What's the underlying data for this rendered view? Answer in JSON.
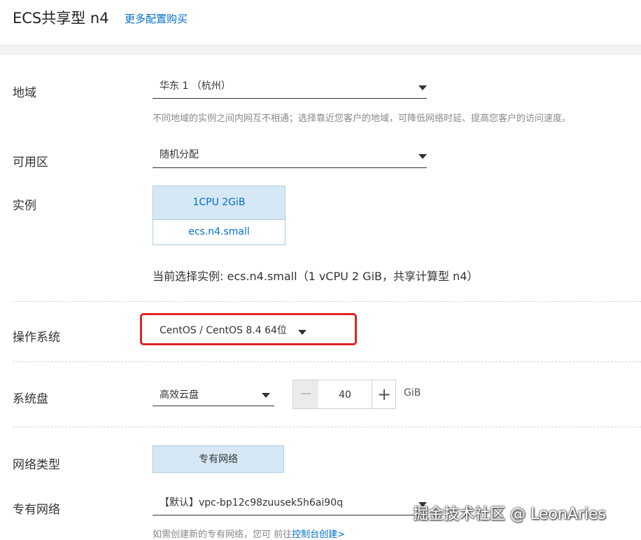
{
  "header": {
    "title": "ECS共享型 n4",
    "more_link": "更多配置购买"
  },
  "region": {
    "label": "地域",
    "value": "华东 1 （杭州）",
    "hint": "不同地域的实例之间内网互不相通；选择靠近您客户的地域，可降低网络时延、提高您客户的访问速度。"
  },
  "zone": {
    "label": "可用区",
    "value": "随机分配"
  },
  "instance": {
    "label": "实例",
    "card_spec": "1CPU 2GiB",
    "card_type": "ecs.n4.small",
    "current": "当前选择实例: ecs.n4.small（1 vCPU 2 GiB，共享计算型 n4）"
  },
  "os": {
    "label": "操作系统",
    "value": "CentOS / CentOS 8.4 64位"
  },
  "disk": {
    "label": "系统盘",
    "type": "高效云盘",
    "minus": "−",
    "size": "40",
    "plus": "+",
    "unit": "GiB"
  },
  "network_type": {
    "label": "网络类型",
    "button": "专有网络"
  },
  "vpc": {
    "label": "专有网络",
    "value": "【默认】vpc-bp12c98zuusek5h6ai90q",
    "note_prefix": "如需创建新的专有网络，您可 前往",
    "note_link": "控制台创建>"
  },
  "watermark": "掘金技术社区 @ LeonAries",
  "colors": {
    "accent": "#0070cc",
    "selected_bg": "#d6e8f5",
    "highlight": "#e02424"
  }
}
